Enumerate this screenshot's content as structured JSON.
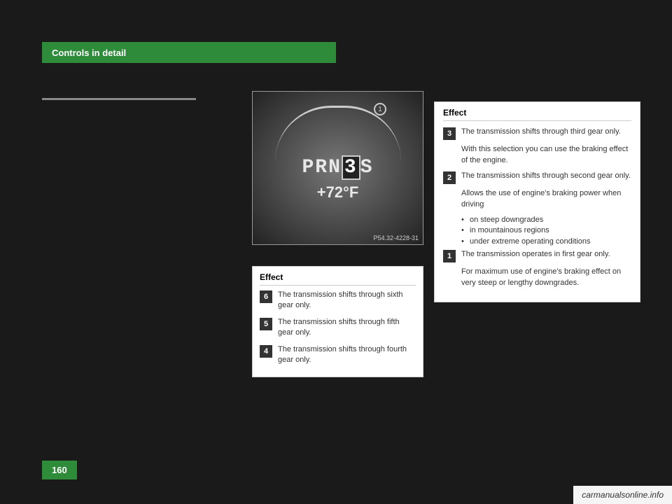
{
  "header": {
    "title": "Controls in detail"
  },
  "dashboard": {
    "display": "PRN",
    "gear": "3",
    "selector": "S",
    "temp": "+72°F",
    "circle_label": "1",
    "image_ref": "P54.32-4228-31"
  },
  "table_lower": {
    "header": "Effect",
    "rows": [
      {
        "gear": "6",
        "description": "The transmission shifts through sixth gear only."
      },
      {
        "gear": "5",
        "description": "The transmission shifts through fifth gear only."
      },
      {
        "gear": "4",
        "description": "The transmission shifts through fourth gear only."
      }
    ]
  },
  "table_right": {
    "header": "Effect",
    "sections": [
      {
        "gear": "3",
        "main_desc": "The transmission shifts through third gear only.",
        "sub_desc": "With this selection you can use the braking effect of the engine.",
        "bullets": []
      },
      {
        "gear": "2",
        "main_desc": "The transmission shifts through second gear only.",
        "sub_desc": "Allows the use of engine's braking power when driving",
        "bullets": [
          "on steep downgrades",
          "in mountainous regions",
          "under extreme operating conditions"
        ]
      },
      {
        "gear": "1",
        "main_desc": "The transmission operates in first gear only.",
        "sub_desc": "For maximum use of engine's braking effect on very steep or lengthy downgrades.",
        "bullets": []
      }
    ]
  },
  "page_number": "160",
  "watermark": "carmanualsonline.info"
}
